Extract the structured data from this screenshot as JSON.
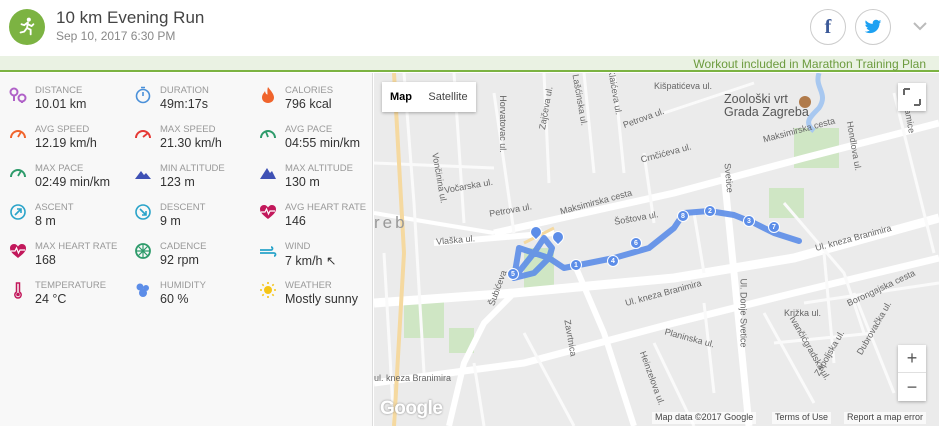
{
  "header": {
    "title": "10 km Evening Run",
    "date": "Sep 10, 2017 6:30 PM",
    "facebook_glyph": "f",
    "activity_icon": "running-person-icon"
  },
  "plan_banner": "Workout included in Marathon Training Plan",
  "stats": [
    {
      "label": "DISTANCE",
      "value": "10.01 km",
      "icon": "distance-icon",
      "color": "#b061c8"
    },
    {
      "label": "DURATION",
      "value": "49m:17s",
      "icon": "stopwatch-icon",
      "color": "#4a90d9"
    },
    {
      "label": "CALORIES",
      "value": "796 kcal",
      "icon": "flame-icon",
      "color": "#f0642c"
    },
    {
      "label": "AVG SPEED",
      "value": "12.19 km/h",
      "icon": "speedometer-icon",
      "color": "#f0642c"
    },
    {
      "label": "MAX SPEED",
      "value": "21.30 km/h",
      "icon": "speedometer-icon",
      "color": "#e53935"
    },
    {
      "label": "AVG PACE",
      "value": "04:55 min/km",
      "icon": "pace-gauge-icon",
      "color": "#2e9b6b"
    },
    {
      "label": "MAX PACE",
      "value": "02:49 min/km",
      "icon": "pace-gauge-icon",
      "color": "#2e9b6b"
    },
    {
      "label": "MIN ALTITUDE",
      "value": "123 m",
      "icon": "mountain-icon",
      "color": "#3f51b5"
    },
    {
      "label": "MAX ALTITUDE",
      "value": "130 m",
      "icon": "mountain-icon",
      "color": "#3f51b5"
    },
    {
      "label": "ASCENT",
      "value": "8 m",
      "icon": "ascent-icon",
      "color": "#29a3c9"
    },
    {
      "label": "DESCENT",
      "value": "9 m",
      "icon": "descent-icon",
      "color": "#29a3c9"
    },
    {
      "label": "AVG HEART RATE",
      "value": "146",
      "icon": "heart-rate-icon",
      "color": "#c2185b"
    },
    {
      "label": "MAX HEART RATE",
      "value": "168",
      "icon": "heart-rate-icon",
      "color": "#c2185b"
    },
    {
      "label": "CADENCE",
      "value": "92 rpm",
      "icon": "cadence-wheel-icon",
      "color": "#2e9b6b"
    },
    {
      "label": "WIND",
      "value": "7 km/h ↖",
      "icon": "wind-icon",
      "color": "#29a3c9"
    },
    {
      "label": "TEMPERATURE",
      "value": "24 °C",
      "icon": "thermometer-icon",
      "color": "#c2185b"
    },
    {
      "label": "HUMIDITY",
      "value": "60 %",
      "icon": "humidity-icon",
      "color": "#5c8de8"
    },
    {
      "label": "WEATHER",
      "value": "Mostly sunny",
      "icon": "sun-icon",
      "color": "#f5c518"
    }
  ],
  "map": {
    "tabs": [
      "Map",
      "Satellite"
    ],
    "active_tab": "Map",
    "zoom_in": "+",
    "zoom_out": "−",
    "google_logo": "Google",
    "attribution": "Map data ©2017 Google",
    "terms": "Terms of Use",
    "report": "Report a map error",
    "poi": "Zoološki vrt\nGrada Zagreba",
    "city_fragment": "reb",
    "streets": [
      "Kišpatićeva ul.",
      "Ramice",
      "Maksimirska cesta",
      "Hondlova ul.",
      "Petrova ul.",
      "Crnčićeva ul.",
      "Vočarska ul.",
      "Maksimirska cesta",
      "Šoštova ul.",
      "Petrova ul.",
      "Vlaška ul.",
      "Ul. kneza Branimira",
      "Ul. kneza Branimira",
      "Ul. Donje Svetice",
      "Svetice",
      "Borongajska cesta",
      "Dubrovačka ul.",
      "Križka ul.",
      "Ivančićgradska ul.",
      "Zapoljska ul.",
      "Planinska ul.",
      "Heinzelova ul.",
      "Zavrtnica",
      "Šubićeva",
      "Horvatovac ul.",
      "Vončinina ul.",
      "Lašćinska ul.",
      "Zajčeva ul.",
      "Klaićeva ul.",
      "Ribnjačka ul.",
      "Bukovačka",
      "ul. kneza Branimira"
    ],
    "route_markers": [
      "1",
      "2",
      "3",
      "4",
      "5",
      "6",
      "7",
      "8"
    ]
  },
  "colors": {
    "brand_green": "#7cb342",
    "route_blue": "#5c8de8",
    "facebook_blue": "#3b5998",
    "twitter_blue": "#1da1f2"
  }
}
